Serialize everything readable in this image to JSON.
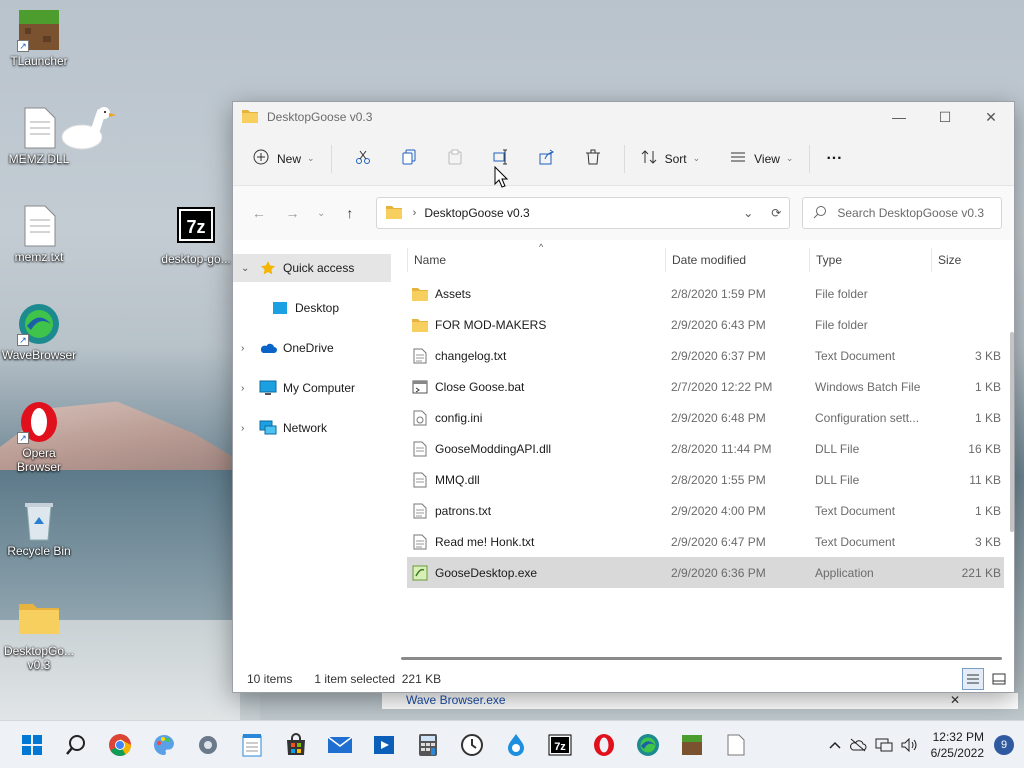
{
  "desktop": {
    "icons": [
      {
        "label": "TLauncher"
      },
      {
        "label": "MEMZ.DLL"
      },
      {
        "label": "memz.txt"
      },
      {
        "label": "desktop-go..."
      },
      {
        "label": "WaveBrowser"
      },
      {
        "label": "Opera Browser"
      },
      {
        "label": "Recycle Bin"
      },
      {
        "label": "DesktopGo... v0.3"
      }
    ]
  },
  "window": {
    "title": "DesktopGoose v0.3",
    "commandbar": {
      "new_label": "New",
      "sort_label": "Sort",
      "view_label": "View",
      "more_label": "···"
    },
    "address": {
      "path": "DesktopGoose v0.3",
      "search_placeholder": "Search DesktopGoose v0.3"
    },
    "navpane": {
      "items": [
        {
          "label": "Quick access",
          "icon": "star-icon",
          "expanded": true,
          "selected": true
        },
        {
          "label": "Desktop",
          "icon": "desktop-icon",
          "child": true
        },
        {
          "label": "OneDrive",
          "icon": "cloud-icon"
        },
        {
          "label": "My Computer",
          "icon": "computer-icon"
        },
        {
          "label": "Network",
          "icon": "network-icon"
        }
      ]
    },
    "columns": {
      "name": "Name",
      "date": "Date modified",
      "type": "Type",
      "size": "Size"
    },
    "files": [
      {
        "name": "Assets",
        "date": "2/8/2020 1:59 PM",
        "type": "File folder",
        "size": "",
        "icon": "folder-icon"
      },
      {
        "name": "FOR MOD-MAKERS",
        "date": "2/9/2020 6:43 PM",
        "type": "File folder",
        "size": "",
        "icon": "folder-icon"
      },
      {
        "name": "changelog.txt",
        "date": "2/9/2020 6:37 PM",
        "type": "Text Document",
        "size": "3 KB",
        "icon": "text-file-icon"
      },
      {
        "name": "Close Goose.bat",
        "date": "2/7/2020 12:22 PM",
        "type": "Windows Batch File",
        "size": "1 KB",
        "icon": "batch-file-icon"
      },
      {
        "name": "config.ini",
        "date": "2/9/2020 6:48 PM",
        "type": "Configuration sett...",
        "size": "1 KB",
        "icon": "config-file-icon"
      },
      {
        "name": "GooseModdingAPI.dll",
        "date": "2/8/2020 11:44 PM",
        "type": "DLL File",
        "size": "16 KB",
        "icon": "dll-file-icon"
      },
      {
        "name": "MMQ.dll",
        "date": "2/8/2020 1:55 PM",
        "type": "DLL File",
        "size": "11 KB",
        "icon": "dll-file-icon"
      },
      {
        "name": "patrons.txt",
        "date": "2/9/2020 4:00 PM",
        "type": "Text Document",
        "size": "1 KB",
        "icon": "text-file-icon"
      },
      {
        "name": "Read me! Honk.txt",
        "date": "2/9/2020 6:47 PM",
        "type": "Text Document",
        "size": "3 KB",
        "icon": "text-file-icon"
      },
      {
        "name": "GooseDesktop.exe",
        "date": "2/9/2020 6:36 PM",
        "type": "Application",
        "size": "221 KB",
        "icon": "exe-file-icon",
        "selected": true
      }
    ],
    "status": {
      "count": "10 items",
      "selection": "1 item selected  221 KB"
    }
  },
  "background_strip": {
    "text": "Wave Browser.exe"
  },
  "taskbar": {
    "apps": [
      "start-icon",
      "search-icon",
      "chrome-icon",
      "paint-icon",
      "settings-icon",
      "notepad-icon",
      "store-icon",
      "mail-icon",
      "media-player-icon",
      "calculator-icon",
      "clock-icon",
      "browser-drop-icon",
      "7zip-icon",
      "opera-icon",
      "wavebrowser-icon",
      "minecraft-icon",
      "file-icon"
    ],
    "time": "12:32 PM",
    "date": "6/25/2022",
    "notifications": "9"
  },
  "colors": {
    "folder": "#f2c55c",
    "selection": "#d9d9d9",
    "accent": "#2f5aa0"
  }
}
